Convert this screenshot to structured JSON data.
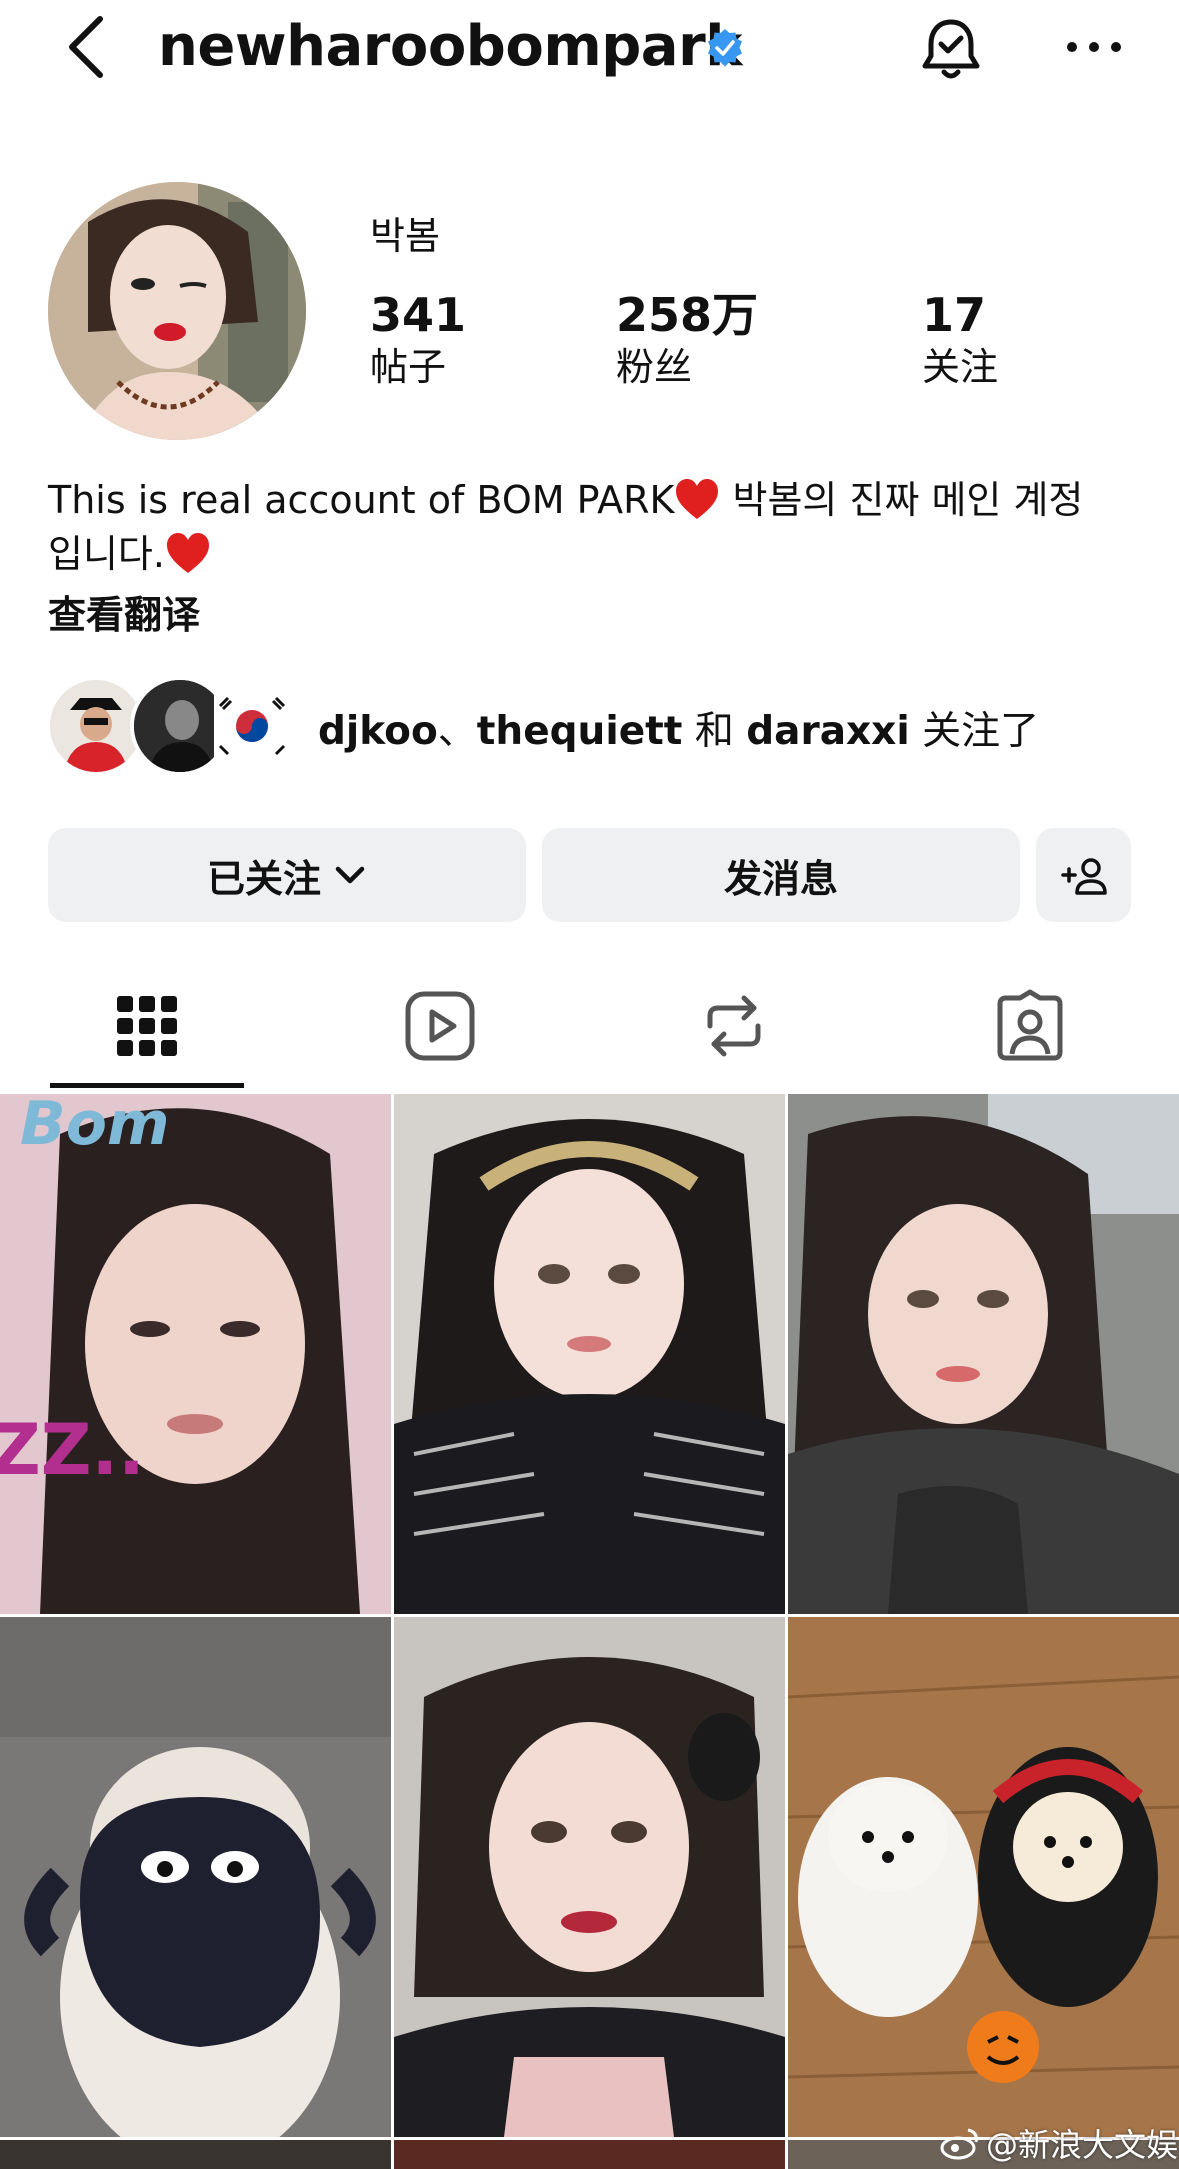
{
  "header": {
    "username": "newharoobompark"
  },
  "profile": {
    "display_name": "박봄",
    "stats": [
      {
        "value": "341",
        "label": "帖子"
      },
      {
        "value": "258万",
        "label": "粉丝"
      },
      {
        "value": "17",
        "label": "关注"
      }
    ]
  },
  "bio": {
    "line1": "This is real account of BOM PARK",
    "line1b": " 박봄의 진짜 메인 계정",
    "line2": "입니다.",
    "translate": "查看翻译"
  },
  "followed_by": {
    "user1": "djkoo",
    "sep1": "、",
    "user2": "thequiett",
    "sep2": " 和 ",
    "user3": "daraxxi",
    "suffix": " 关注了"
  },
  "actions": {
    "following": "已关注",
    "message": "发消息"
  },
  "tabs": [
    "posts-grid",
    "reels",
    "reposts",
    "tagged"
  ],
  "watermark": "@新浪大文娱",
  "colors": {
    "verified": "#3897f0",
    "button_bg": "#eef0f2",
    "heart": "#e0201f"
  }
}
